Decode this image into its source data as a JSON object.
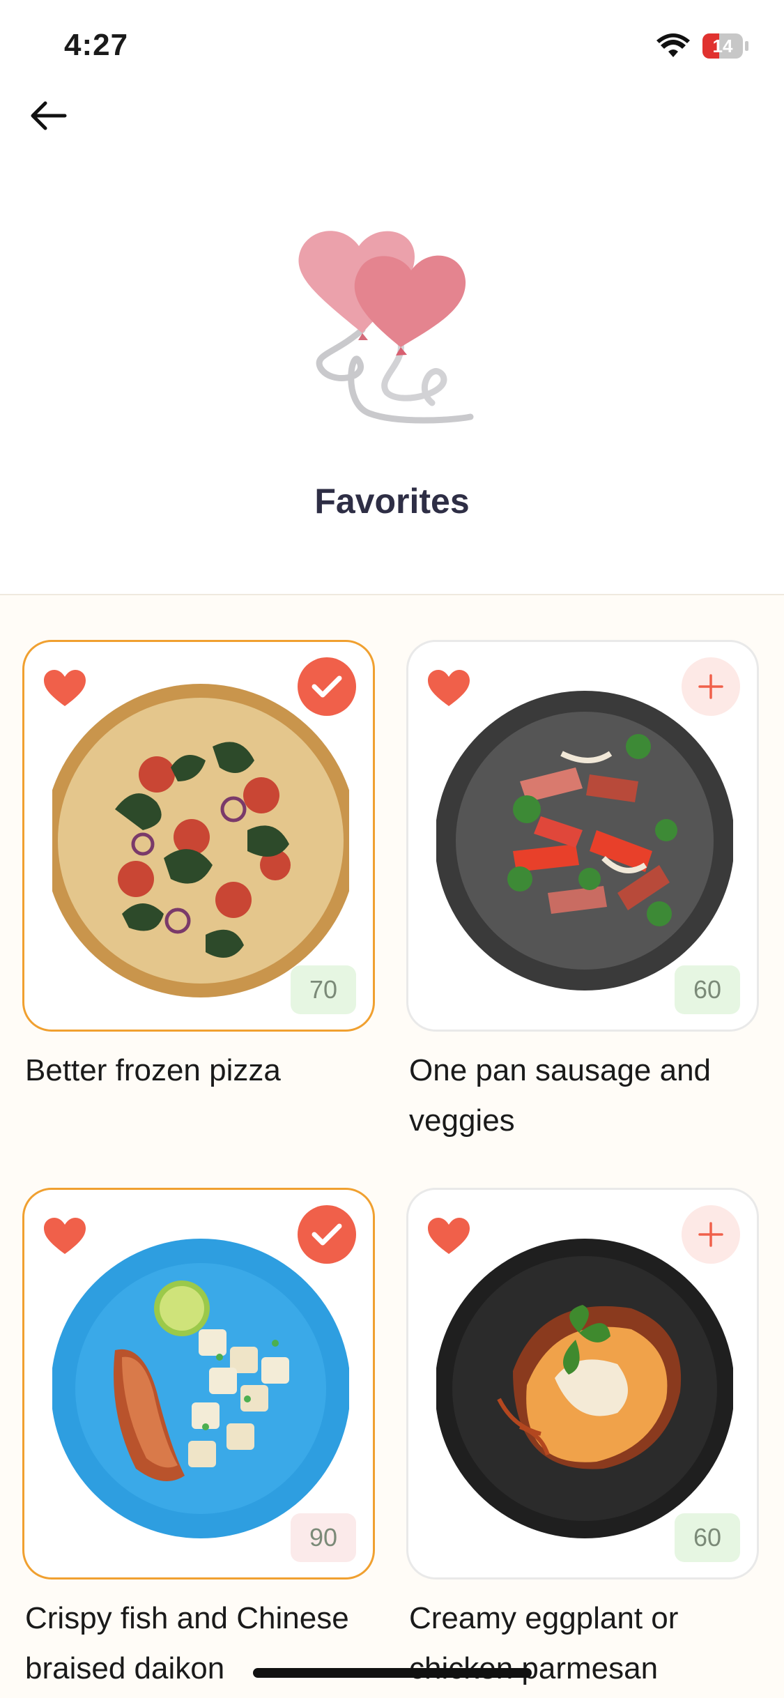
{
  "status": {
    "time": "4:27",
    "battery": "14",
    "battery_level": 0.14
  },
  "header": {
    "back_icon": "arrow-left-icon",
    "hero_icon": "heart-balloons-icon",
    "title": "Favorites"
  },
  "colors": {
    "accent": "#f0604a",
    "selected_border": "#f0a030",
    "score_green_bg": "#e6f6e2",
    "score_pink_bg": "#fbeaea",
    "title": "#2e2e45"
  },
  "recipes": [
    {
      "title": "Better frozen pizza",
      "score": "70",
      "selected": true
    },
    {
      "title": "One pan sausage and veggies",
      "score": "60",
      "selected": false
    },
    {
      "title": "Crispy fish and Chinese braised daikon",
      "score": "90",
      "selected": true
    },
    {
      "title": "Creamy eggplant or chicken parmesan",
      "score": "60",
      "selected": false
    }
  ]
}
